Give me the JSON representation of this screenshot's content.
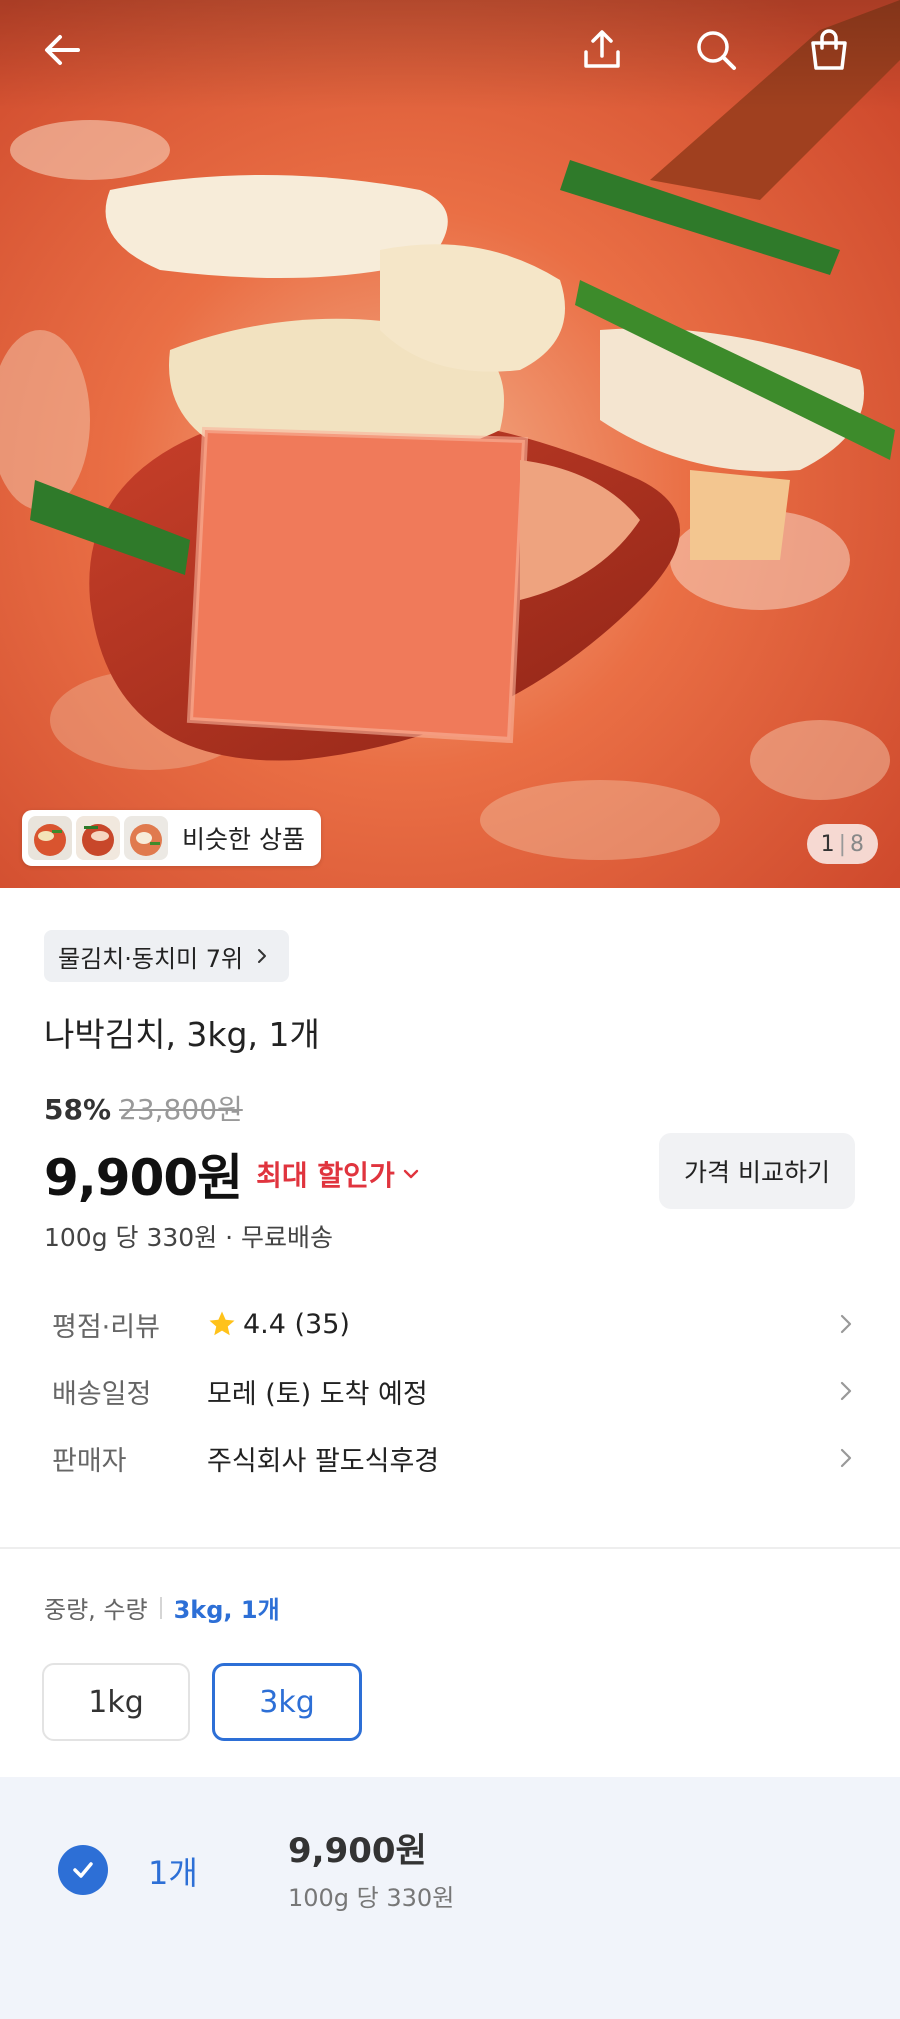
{
  "header": {
    "back_icon": "arrow-left-icon",
    "share_icon": "share-upload-icon",
    "search_icon": "search-icon",
    "cart_icon": "shopping-bag-icon"
  },
  "gallery": {
    "similar_label": "비슷한 상품",
    "current": "1",
    "total": "8"
  },
  "product": {
    "rank_chip": "물김치·동치미 7위",
    "title": "나박김치, 3kg, 1개",
    "discount": "58%",
    "original_price": "23,800원",
    "price": "9,900원",
    "max_discount_label": "최대 할인가",
    "compare_button": "가격 비교하기",
    "unit_price": "100g 당 330원 · 무료배송"
  },
  "info": {
    "rating_key": "평점·리뷰",
    "rating_value": "4.4 (35)",
    "delivery_key": "배송일정",
    "delivery_value": "모레 (토) 도착 예정",
    "seller_key": "판매자",
    "seller_value": "주식회사 팔도식후경"
  },
  "options": {
    "header_label": "중량, 수량",
    "selected": "3kg, 1개",
    "weights": [
      "1kg",
      "3kg"
    ],
    "quantity_label": "1개",
    "quantity_price": "9,900원",
    "quantity_unit_price": "100g 당 330원"
  },
  "colors": {
    "accent_blue": "#2d6fd6",
    "discount_red": "#e0343e",
    "star_yellow": "#ffc21a"
  }
}
